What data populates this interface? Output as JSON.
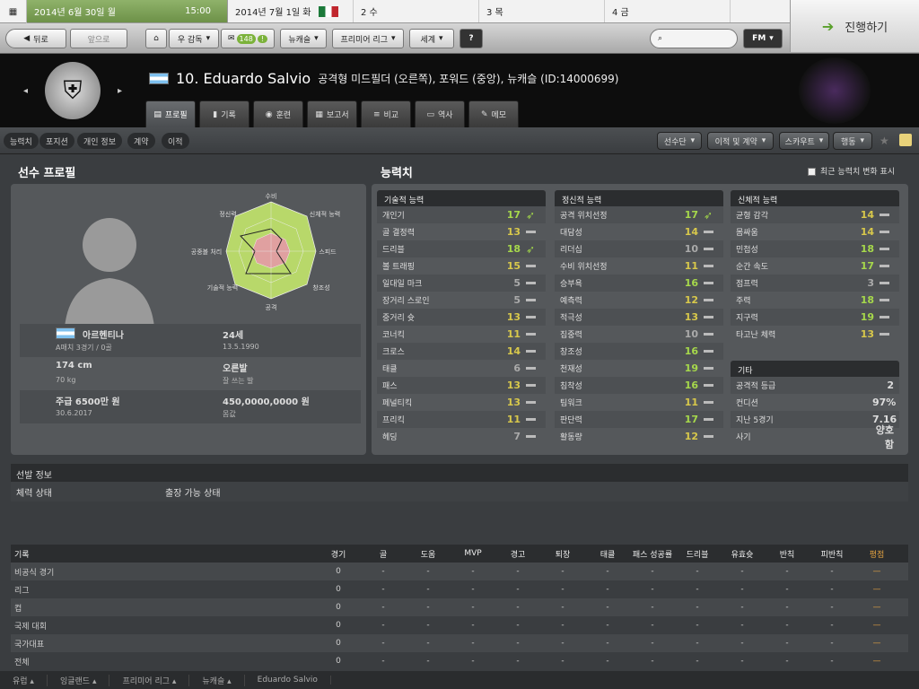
{
  "calendar": {
    "today_date": "2014년 6월 30일",
    "today_day": "월",
    "today_time": "15:00",
    "days": [
      {
        "label": "2014년 7월 1일 화"
      },
      {
        "label": "2 수"
      },
      {
        "label": "3 목"
      },
      {
        "label": "4 금"
      }
    ],
    "nav_prev": "◂",
    "nav_next": "▸"
  },
  "toolbar": {
    "back": "뒤로",
    "forward": "앞으로",
    "home_menu": "우 감독",
    "badge_count": "148",
    "club_menu": "뉴캐슬",
    "league_menu": "프리미어 리그",
    "world_menu": "세계",
    "help": "?",
    "fm_menu": "FM",
    "continue": "진행하기"
  },
  "player": {
    "number_name": "10. Eduardo Salvio",
    "position": "공격형 미드필더 (오른쪽), 포워드 (중앙), 뉴캐슬 (ID:14000699)"
  },
  "tabs": [
    {
      "label": "프로필"
    },
    {
      "label": "기록"
    },
    {
      "label": "훈련"
    },
    {
      "label": "보고서"
    },
    {
      "label": "비교"
    },
    {
      "label": "역사"
    },
    {
      "label": "메모"
    }
  ],
  "subnav": {
    "items": [
      "능력치",
      "포지션",
      "개인 정보",
      "계약",
      "이적"
    ],
    "right": [
      "선수단",
      "이적 및 계약",
      "스카우트",
      "행동"
    ]
  },
  "profile": {
    "heading": "선수 프로필",
    "radar_labels": [
      "수비",
      "신체적 능력",
      "스피드",
      "창조성",
      "공격",
      "기술적 능력",
      "공중볼 처리",
      "정신력"
    ],
    "nation": "아르헨티나",
    "caps": "A매치 3경기 / 0골",
    "age": "24세",
    "dob": "13.5.1990",
    "height": "174 cm",
    "weight": "70 kg",
    "foot": "오른발",
    "foot_note": "잘 쓰는 발",
    "wage": "주급 6500만 원",
    "contract": "30.6.2017",
    "value": "450,0000,0000 원",
    "value_label": "몸값"
  },
  "attributes": {
    "heading": "능력치",
    "toggle_label": "최근 능력치 변화 표시",
    "technical": {
      "title": "기술적 능력",
      "rows": [
        [
          "개인기",
          "17",
          "up"
        ],
        [
          "골 결정력",
          "13",
          "dash"
        ],
        [
          "드리블",
          "18",
          "up"
        ],
        [
          "볼 트래핑",
          "15",
          "dash"
        ],
        [
          "일대일 마크",
          "5",
          "dash"
        ],
        [
          "장거리 스로인",
          "5",
          "dash"
        ],
        [
          "중거리 슛",
          "13",
          "dash"
        ],
        [
          "코너킥",
          "11",
          "dash"
        ],
        [
          "크로스",
          "14",
          "dash"
        ],
        [
          "태클",
          "6",
          "dash"
        ],
        [
          "패스",
          "13",
          "dash"
        ],
        [
          "페널티킥",
          "13",
          "dash"
        ],
        [
          "프리킥",
          "11",
          "dash"
        ],
        [
          "헤딩",
          "7",
          "dash"
        ]
      ]
    },
    "mental": {
      "title": "정신적 능력",
      "rows": [
        [
          "공격 위치선정",
          "17",
          "up"
        ],
        [
          "대담성",
          "14",
          "dash"
        ],
        [
          "리더십",
          "10",
          "dash"
        ],
        [
          "수비 위치선정",
          "11",
          "dash"
        ],
        [
          "승부욕",
          "16",
          "dash"
        ],
        [
          "예측력",
          "12",
          "dash"
        ],
        [
          "적극성",
          "13",
          "dash"
        ],
        [
          "집중력",
          "10",
          "dash"
        ],
        [
          "창조성",
          "16",
          "dash"
        ],
        [
          "천재성",
          "19",
          "dash"
        ],
        [
          "침착성",
          "16",
          "dash"
        ],
        [
          "팀워크",
          "11",
          "dash"
        ],
        [
          "판단력",
          "17",
          "dash"
        ],
        [
          "활동량",
          "12",
          "dash"
        ]
      ]
    },
    "physical": {
      "title": "신체적 능력",
      "rows": [
        [
          "균형 감각",
          "14",
          "dash"
        ],
        [
          "몸싸움",
          "14",
          "dash"
        ],
        [
          "민첩성",
          "18",
          "dash"
        ],
        [
          "순간 속도",
          "17",
          "dash"
        ],
        [
          "점프력",
          "3",
          "dash"
        ],
        [
          "주력",
          "18",
          "dash"
        ],
        [
          "지구력",
          "19",
          "dash"
        ],
        [
          "타고난 체력",
          "13",
          "dash"
        ]
      ]
    },
    "other": {
      "title": "기타",
      "rows": [
        [
          "공격적 등급",
          "2"
        ],
        [
          "컨디션",
          "97%"
        ],
        [
          "지난 5경기",
          "7.16"
        ],
        [
          "사기",
          "양호함"
        ]
      ]
    }
  },
  "selection": {
    "title": "선발 정보",
    "key": "체력 상태",
    "val": "출장 가능 상태"
  },
  "records": {
    "headers": [
      "기록",
      "경기",
      "골",
      "도움",
      "MVP",
      "경고",
      "퇴장",
      "태클",
      "패스 성공률",
      "드리블",
      "유효슛",
      "반칙",
      "피반칙",
      "평점"
    ],
    "rows": [
      [
        "비공식 경기",
        "0",
        "-",
        "-",
        "-",
        "-",
        "-",
        "-",
        "-",
        "-",
        "-",
        "-",
        "-",
        "—"
      ],
      [
        "리그",
        "0",
        "-",
        "-",
        "-",
        "-",
        "-",
        "-",
        "-",
        "-",
        "-",
        "-",
        "-",
        "—"
      ],
      [
        "컵",
        "0",
        "-",
        "-",
        "-",
        "-",
        "-",
        "-",
        "-",
        "-",
        "-",
        "-",
        "-",
        "—"
      ],
      [
        "국제 대회",
        "0",
        "-",
        "-",
        "-",
        "-",
        "-",
        "-",
        "-",
        "-",
        "-",
        "-",
        "-",
        "—"
      ],
      [
        "국가대표",
        "0",
        "-",
        "-",
        "-",
        "-",
        "-",
        "-",
        "-",
        "-",
        "-",
        "-",
        "-",
        "—"
      ],
      [
        "전체",
        "0",
        "-",
        "-",
        "-",
        "-",
        "-",
        "-",
        "-",
        "-",
        "-",
        "-",
        "-",
        "—"
      ]
    ]
  },
  "footer": [
    "유럽",
    "잉글랜드",
    "프리미어 리그",
    "뉴캐슬",
    "Eduardo Salvio"
  ]
}
